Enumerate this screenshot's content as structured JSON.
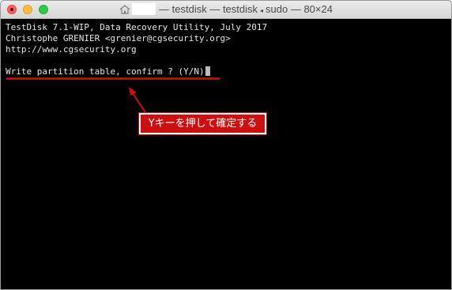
{
  "window": {
    "title": "— testdisk — testdisk",
    "title_sudo": "sudo — 80×24",
    "title_separator_icon": "sort-arrow-icon",
    "home_icon": "home-folder-icon",
    "controls": {
      "close": "#fc605c",
      "minimize": "#fdbc40",
      "maximize": "#34c84a"
    }
  },
  "terminal": {
    "lines": [
      "TestDisk 7.1-WIP, Data Recovery Utility, July 2017",
      "Christophe GRENIER <grenier@cgsecurity.org>",
      "http://www.cgsecurity.org",
      "",
      "Write partition table, confirm ? (Y/N)"
    ],
    "text_color": "#e6e6e6",
    "background": "#000000"
  },
  "annotation": {
    "callout_text": "Yキーを押して確定する",
    "color": "#cc1010"
  }
}
